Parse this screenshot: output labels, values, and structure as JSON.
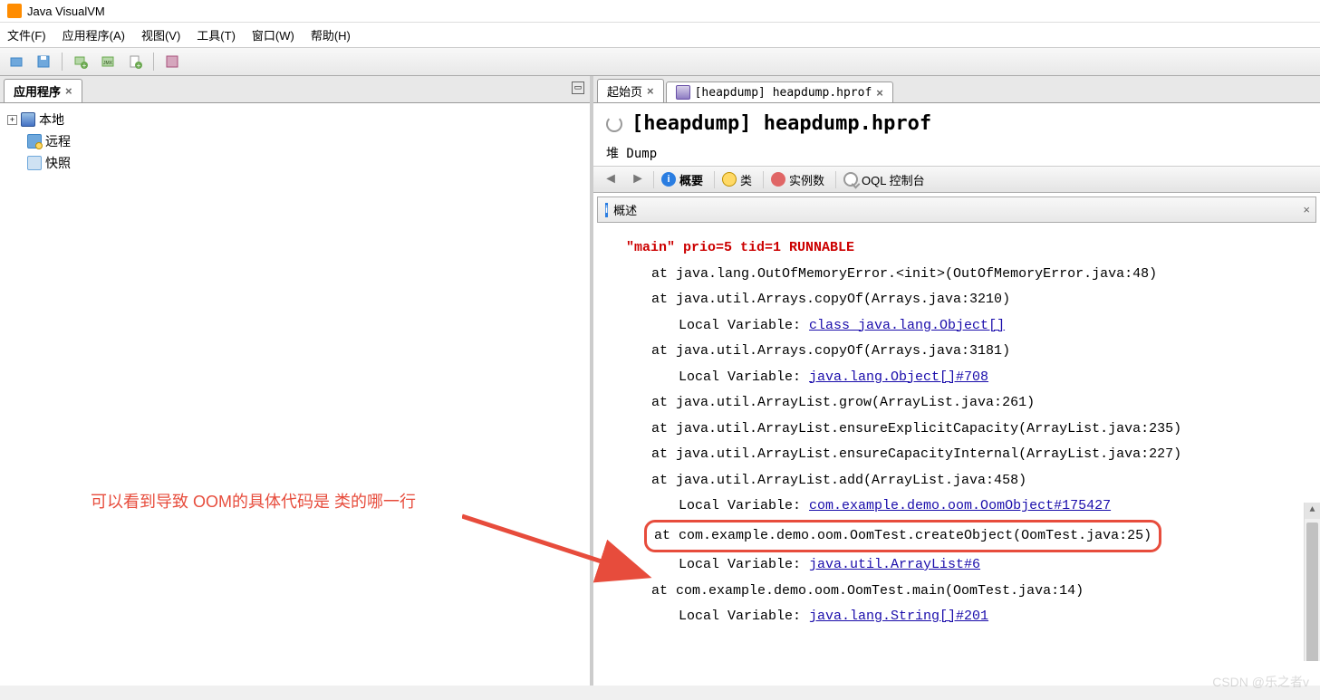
{
  "window": {
    "title": "Java VisualVM"
  },
  "menu": {
    "file": "文件(F)",
    "app": "应用程序(A)",
    "view": "视图(V)",
    "tools": "工具(T)",
    "window": "窗口(W)",
    "help": "帮助(H)"
  },
  "left": {
    "tab": "应用程序",
    "tree": {
      "local": "本地",
      "remote": "远程",
      "snapshot": "快照"
    }
  },
  "right": {
    "tabs": {
      "start": "起始页",
      "heap": "[heapdump] heapdump.hprof"
    },
    "title": "[heapdump] heapdump.hprof",
    "subtitle": "堆 Dump",
    "tb": {
      "overview": "概要",
      "classes": "类",
      "instances": "实例数",
      "oql": "OQL 控制台"
    },
    "section": "概述",
    "thread": "\"main\" prio=5 tid=1 RUNNABLE",
    "stack": [
      "at java.lang.OutOfMemoryError.<init>(OutOfMemoryError.java:48)",
      "at java.util.Arrays.copyOf(Arrays.java:3210)",
      {
        "lv": "Local Variable: ",
        "link": "class java.lang.Object[]"
      },
      "at java.util.Arrays.copyOf(Arrays.java:3181)",
      {
        "lv": "Local Variable: ",
        "link": "java.lang.Object[]#708"
      },
      "at java.util.ArrayList.grow(ArrayList.java:261)",
      "at java.util.ArrayList.ensureExplicitCapacity(ArrayList.java:235)",
      "at java.util.ArrayList.ensureCapacityInternal(ArrayList.java:227)",
      "at java.util.ArrayList.add(ArrayList.java:458)",
      {
        "lv": "Local Variable: ",
        "link": "com.example.demo.oom.OomObject#175427"
      },
      {
        "hl": "at com.example.demo.oom.OomTest.createObject(OomTest.java:25)"
      },
      {
        "lv": "Local Variable: ",
        "link": "java.util.ArrayList#6"
      },
      "at com.example.demo.oom.OomTest.main(OomTest.java:14)",
      {
        "lv": "Local Variable: ",
        "link": "java.lang.String[]#201"
      }
    ]
  },
  "annotation": "可以看到导致 OOM的具体代码是 类的哪一行",
  "watermark": "CSDN @乐之者v"
}
